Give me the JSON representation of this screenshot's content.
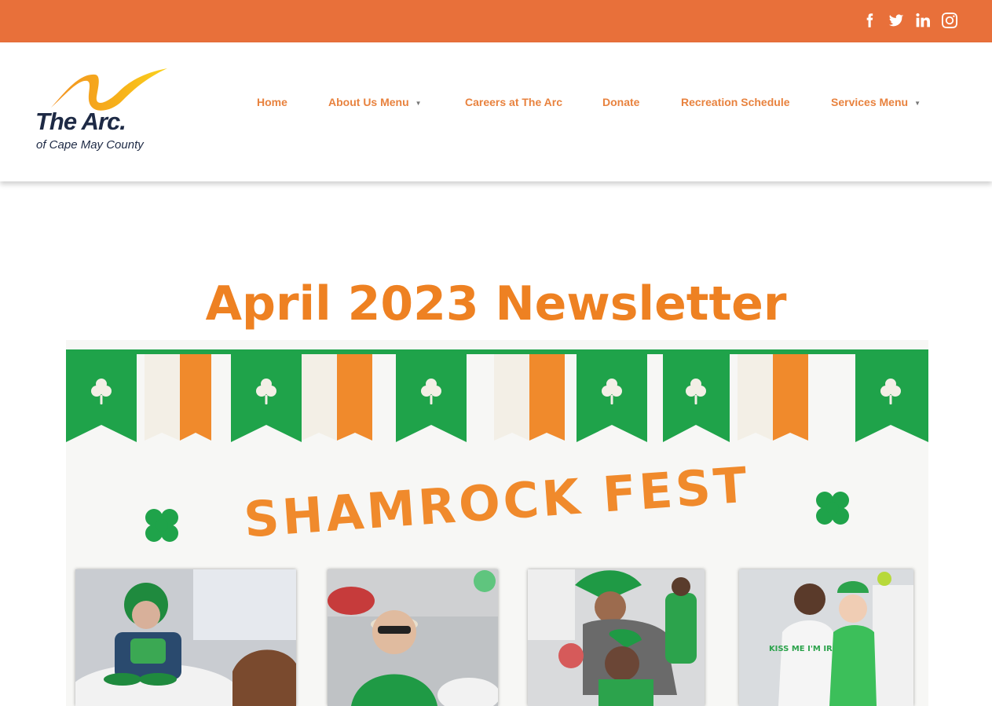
{
  "colors": {
    "topbar": "#e8703a",
    "nav_text": "#e8823e",
    "title": "#ee8122",
    "logo_text": "#1e2a45",
    "banner_green": "#1fa34a",
    "banner_orange": "#f08a2c"
  },
  "social": [
    {
      "name": "facebook-icon"
    },
    {
      "name": "twitter-icon"
    },
    {
      "name": "linkedin-icon"
    },
    {
      "name": "instagram-icon"
    }
  ],
  "logo": {
    "title": "The Arc.",
    "subtitle": "of Cape May County"
  },
  "nav": {
    "home": "Home",
    "about": "About Us Menu",
    "careers": "Careers at The Arc",
    "donate": "Donate",
    "recreation": "Recreation Schedule",
    "services": "Services Menu"
  },
  "page": {
    "title": "April 2023 Newsletter"
  },
  "banner": {
    "heading": "SHAMROCK FEST",
    "photo_shirt_text": "KISS ME I'M IRISH"
  }
}
